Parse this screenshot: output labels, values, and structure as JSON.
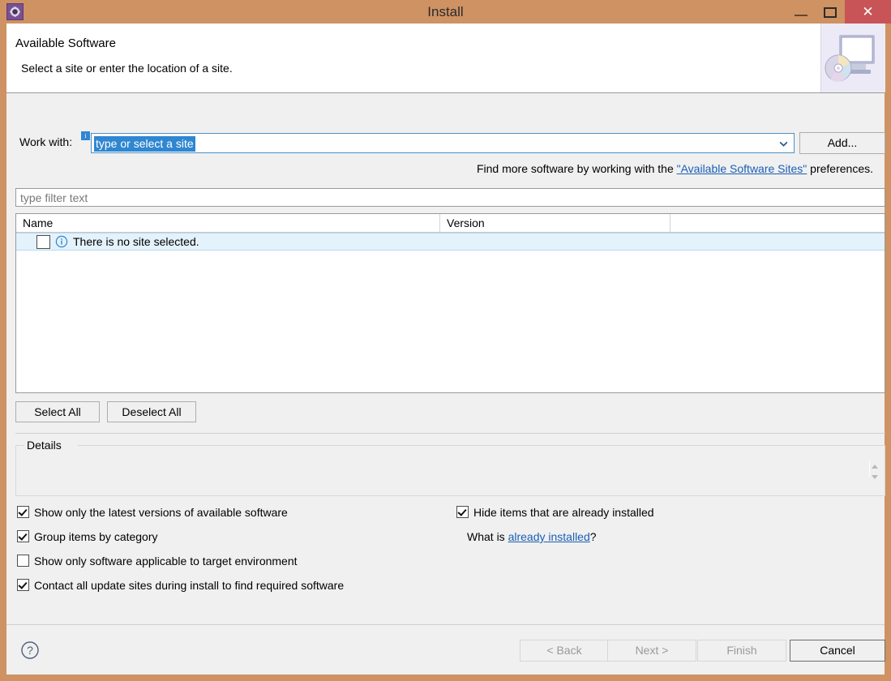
{
  "window": {
    "title": "Install",
    "app_icon": "gear-icon",
    "minimize_label": "–",
    "maximize_label": "□",
    "close_label": "✕",
    "frame_color": "#cf9263",
    "close_color": "#c85458"
  },
  "banner": {
    "title": "Available Software",
    "subtitle": "Select a site or enter the location of a site.",
    "image": "monitor-cd-icon"
  },
  "work_with": {
    "label": "Work with:",
    "info_badge": "i",
    "combo_value": "type or select a site",
    "combo_arrow": "chevron-down-icon",
    "add_button": "Add..."
  },
  "find_more": {
    "prefix": "Find more software by working with the ",
    "link": "\"Available Software Sites\"",
    "suffix": " preferences."
  },
  "filter": {
    "placeholder": "type filter text",
    "value": ""
  },
  "table": {
    "columns": [
      "Name",
      "Version",
      ""
    ],
    "rows": [
      {
        "checked": false,
        "icon": "info-circle-icon",
        "name": "There is no site selected.",
        "version": "",
        "selected": true
      }
    ]
  },
  "selection_buttons": {
    "select_all": "Select All",
    "deselect_all": "Deselect All"
  },
  "details": {
    "label": "Details",
    "content": "",
    "scroll": "up-down-spinner-icon"
  },
  "options": {
    "left": [
      {
        "label": "Show only the latest versions of available software",
        "checked": true
      },
      {
        "label": "Group items by category",
        "checked": true
      },
      {
        "label": "Show only software applicable to target environment",
        "checked": false
      },
      {
        "label": "Contact all update sites during install to find required software",
        "checked": true
      }
    ],
    "right": [
      {
        "label": "Hide items that are already installed",
        "checked": true
      }
    ],
    "what_is": {
      "prefix": "What is ",
      "link": "already installed",
      "suffix": "?"
    }
  },
  "footer": {
    "help": "?",
    "back": "< Back",
    "next": "Next >",
    "finish": "Finish",
    "cancel": "Cancel"
  },
  "colors": {
    "accent_blue": "#2f86d1",
    "link_blue": "#1a5fb4",
    "selection_row": "#e4f2fb",
    "dialog_bg": "#f0f0f0"
  }
}
